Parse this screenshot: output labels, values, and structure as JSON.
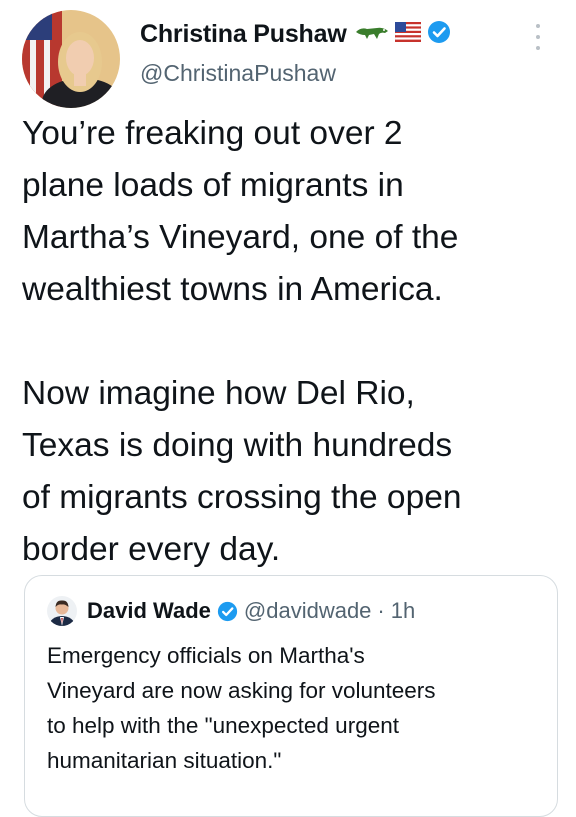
{
  "tweet": {
    "author": {
      "display_name": "Christina Pushaw",
      "handle": "@ChristinaPushaw",
      "name_icons": [
        "alligator-icon",
        "us-flag-icon",
        "verified-badge-icon"
      ]
    },
    "text_lines": [
      "You’re freaking out over 2",
      "plane loads of migrants in",
      "Martha’s Vineyard, one of the",
      "wealthiest towns in America.",
      "",
      "Now imagine how Del Rio,",
      "Texas is doing with hundreds",
      "of migrants crossing the open",
      "border every day."
    ]
  },
  "quoted_tweet": {
    "display_name": "David Wade",
    "handle": "@davidwade",
    "separator": "·",
    "time": "1h",
    "text_lines": [
      "Emergency officials on Martha's",
      "Vineyard are now asking for volunteers",
      "to help with the \"unexpected urgent",
      "humanitarian situation.\""
    ]
  },
  "colors": {
    "text": "#0f1419",
    "secondary": "#536471",
    "verified": "#1d9bf0",
    "border": "#d6dce0"
  }
}
